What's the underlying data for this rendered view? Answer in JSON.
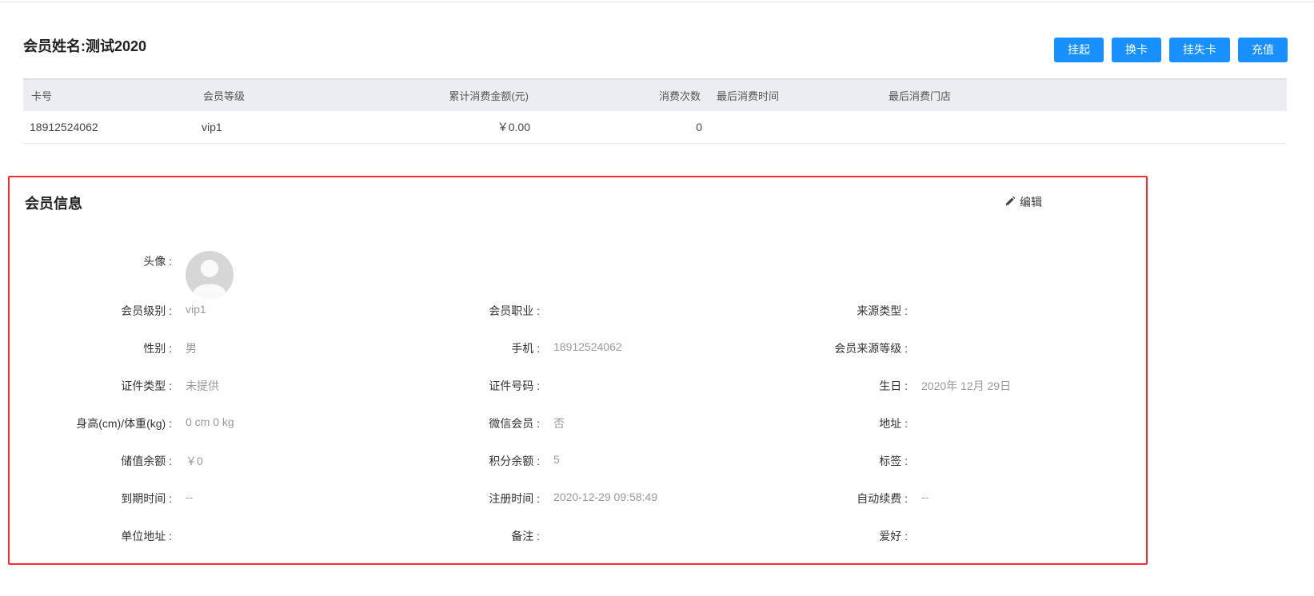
{
  "header": {
    "member_name": "会员姓名:测试2020"
  },
  "actions": {
    "suspend": "挂起",
    "change_card": "换卡",
    "report_loss": "挂失卡",
    "recharge": "充值"
  },
  "card_table": {
    "headers": {
      "card_no": "卡号",
      "level": "会员等级",
      "total_spent": "累计消费金额(元)",
      "visit_count": "消费次数",
      "last_time": "最后消费时间",
      "last_store": "最后消费门店"
    },
    "row": {
      "card_no": "18912524062",
      "level": "vip1",
      "total_spent": "￥0.00",
      "visit_count": "0",
      "last_time": "",
      "last_store": ""
    }
  },
  "info": {
    "title": "会员信息",
    "edit_label": "编辑",
    "avatar_label": "头像 :",
    "col1": {
      "level_label": "会员级别 :",
      "level_value": "vip1",
      "gender_label": "性别 :",
      "gender_value": "男",
      "id_type_label": "证件类型 :",
      "id_type_value": "未提供",
      "height_weight_label": "身高(cm)/体重(kg) :",
      "height_weight_value": "0 cm 0 kg",
      "balance_label": "储值余额 :",
      "balance_value": "￥0",
      "expiry_label": "到期时间 :",
      "expiry_value": "--",
      "company_address_label": "单位地址 :",
      "company_address_value": ""
    },
    "col2": {
      "occupation_label": "会员职业 :",
      "occupation_value": "",
      "phone_label": "手机 :",
      "phone_value": "18912524062",
      "id_no_label": "证件号码 :",
      "id_no_value": "",
      "wechat_label": "微信会员 :",
      "wechat_value": "否",
      "points_label": "积分余额 :",
      "points_value": "5",
      "register_label": "注册时间 :",
      "register_value": "2020-12-29 09:58:49",
      "remark_label": "备注 :",
      "remark_value": ""
    },
    "col3": {
      "source_type_label": "来源类型 :",
      "source_type_value": "",
      "source_level_label": "会员来源等级 :",
      "source_level_value": "",
      "birthday_label": "生日 :",
      "birthday_value": "2020年 12月 29日",
      "address_label": "地址 :",
      "address_value": "",
      "tags_label": "标签 :",
      "tags_value": "",
      "auto_renew_label": "自动续费 :",
      "auto_renew_value": "--",
      "hobby_label": "爱好 :",
      "hobby_value": ""
    }
  }
}
